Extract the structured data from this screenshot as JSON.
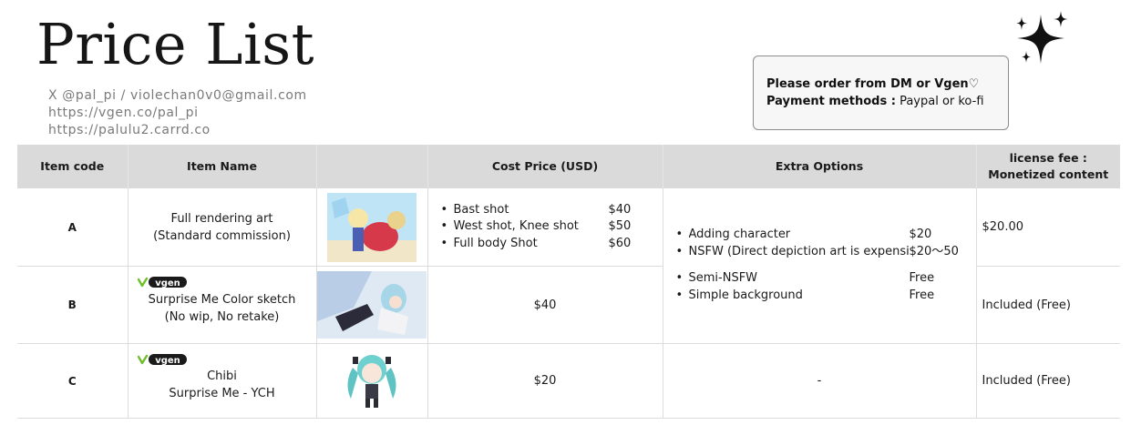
{
  "header": {
    "title": "Price List",
    "contact": [
      "X @pal_pi / violechan0v0@gmail.com",
      "https://vgen.co/pal_pi",
      "https://palulu2.carrd.co"
    ]
  },
  "notice": {
    "order_line": "Please order from DM or Vgen♡",
    "payment_label": "Payment methods :",
    "payment_value": "Paypal or ko-fi"
  },
  "table": {
    "headers": [
      "Item code",
      "Item Name",
      "",
      "Cost Price (USD)",
      "Extra Options",
      "license fee :",
      "Monetized content"
    ],
    "rows": [
      {
        "code": "A",
        "name_line1": "Full rendering art",
        "name_line2": "(Standard commission)",
        "costs": [
          {
            "label": "Bast shot",
            "price": "$40"
          },
          {
            "label": "West shot, Knee shot",
            "price": "$50"
          },
          {
            "label": "Full body Shot",
            "price": "$60"
          }
        ],
        "license": "$20.00"
      },
      {
        "code": "B",
        "name_line1": "Surprise Me Color sketch",
        "name_line2": "(No wip, No retake)",
        "vgen_logo": "vgen",
        "cost": "$40",
        "license": "Included (Free)"
      },
      {
        "code": "C",
        "name_line1": "Chibi",
        "name_line2": "Surprise Me - YCH",
        "vgen_logo": "vgen",
        "cost": "$20",
        "extra": "-",
        "license": "Included (Free)"
      }
    ],
    "extra_options": [
      {
        "label": "Adding character",
        "price": "$20"
      },
      {
        "label": "NSFW (Direct depiction art is expensive",
        "price": "$20～50"
      },
      {
        "label": "Semi-NSFW",
        "price": "Free"
      },
      {
        "label": "Simple background",
        "price": "Free"
      }
    ]
  },
  "icons": [
    "sparkle-icon",
    "vgen-logo",
    "artwork-thumbnail"
  ]
}
